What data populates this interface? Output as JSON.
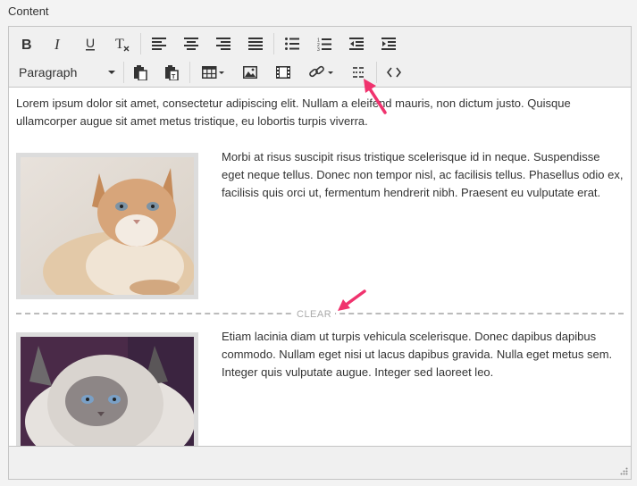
{
  "field_label": "Content",
  "toolbar": {
    "row1": [
      "bold-icon",
      "italic-icon",
      "underline-icon",
      "clear-formatting-icon",
      "align-left-icon",
      "align-center-icon",
      "align-right-icon",
      "align-justify-icon",
      "bullet-list-icon",
      "numbered-list-icon",
      "outdent-icon",
      "indent-icon"
    ],
    "format_select": "Paragraph",
    "row2": [
      "paste-icon",
      "paste-text-icon",
      "table-icon",
      "image-icon",
      "media-icon",
      "link-icon",
      "clear-insert-icon",
      "source-code-icon"
    ]
  },
  "content": {
    "paragraph1": "Lorem ipsum dolor sit amet, consectetur adipiscing elit. Nullam a eleifend mauris, non dictum justo. Quisque ullamcorper augue sit amet metus tristique, eu lobortis turpis viverra.",
    "paragraph2": "Morbi at risus suscipit risus tristique scelerisque id in neque. Suspendisse eget neque tellus. Donec non tempor nisl, ac facilisis tellus. Phasellus odio ex, facilisis quis orci ut, fermentum hendrerit nibh. Praesent eu vulputate erat.",
    "clear_label": "CLEAR",
    "paragraph3": "Etiam lacinia diam ut turpis vehicula scelerisque. Donec dapibus dapibus commodo. Nullam eget nisi ut lacus dapibus gravida. Nulla eget metus sem. Integer quis vulputate augue. Integer sed laoreet leo."
  },
  "colors": {
    "accent_arrow": "#f0336e",
    "toolbar_bg": "#f0f0f0",
    "border": "#c5c5c5"
  }
}
